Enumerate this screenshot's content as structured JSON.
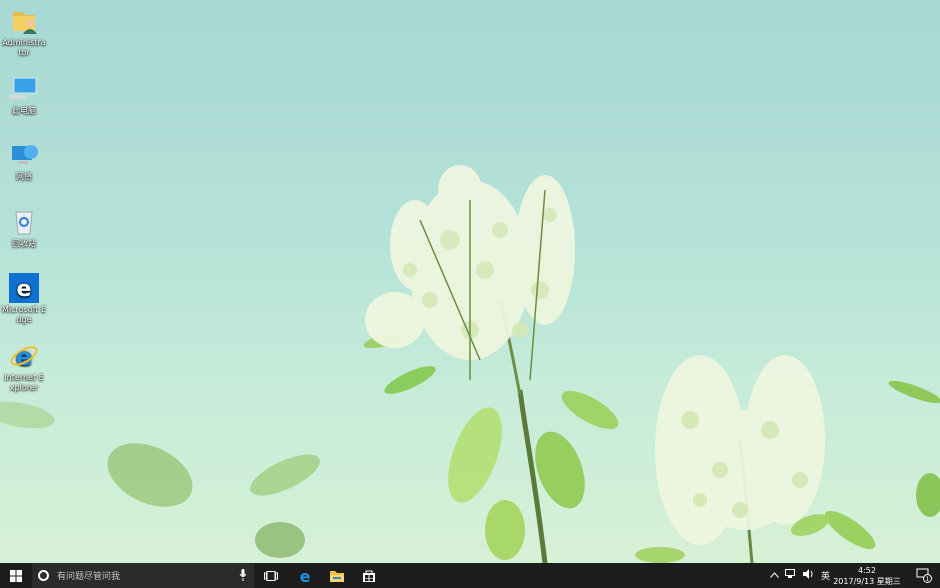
{
  "desktop": {
    "icons": [
      {
        "name": "user-folder-icon",
        "label": "Administrator"
      },
      {
        "name": "this-pc-icon",
        "label": "此电脑"
      },
      {
        "name": "network-icon",
        "label": "网络"
      },
      {
        "name": "recycle-bin-icon",
        "label": "回收站"
      },
      {
        "name": "edge-icon",
        "label": "Microsoft Edge"
      },
      {
        "name": "ie-icon",
        "label": "Internet Explorer"
      }
    ]
  },
  "taskbar": {
    "search_placeholder": "有问题尽管问我",
    "tray_input_method": "英",
    "clock_time": "4:52",
    "clock_date": "2017/9/13 星期三",
    "notification_count": "1"
  },
  "colors": {
    "taskbar_bg": "#1d1d1d",
    "edge_blue": "#1171d1",
    "sky": "#a7d8d3"
  }
}
